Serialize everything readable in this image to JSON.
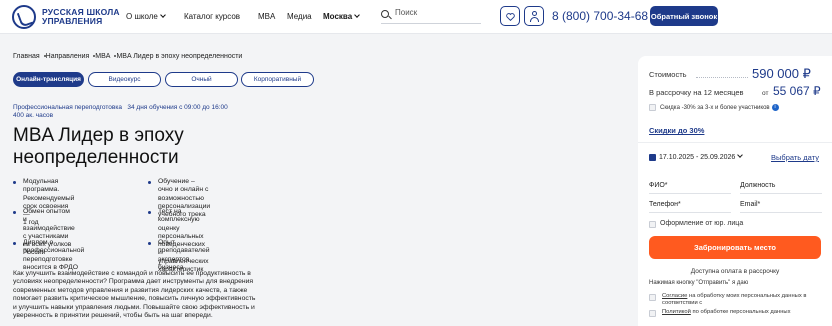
{
  "header": {
    "logo_line1": "РУССКАЯ ШКОЛА",
    "logo_line2": "УПРАВЛЕНИЯ",
    "nav": [
      "О школе",
      "Каталог курсов",
      "MBA",
      "Медиа",
      "Москва"
    ],
    "search_placeholder": "Поиск",
    "phone": "8 (800) 700-34-68",
    "callback": "Обратный звонок",
    "accent": "#1e3a8a"
  },
  "breadcrumb": [
    "Главная",
    "Направления",
    "MBA",
    "MBA Лидер в эпоху неопределенности"
  ],
  "tabs": [
    "Онлайн-трансляция",
    "Видеокурс",
    "Очный",
    "Корпоративный"
  ],
  "meta": {
    "label": "Профессиональная переподготовка",
    "duration": "34 дня обучения с 09:00 до 16:00",
    "hours": "400 ак. часов"
  },
  "title_line1": "MBA Лидер в эпоху",
  "title_line2": "неопределенности",
  "features_left": [
    [
      "Модульная программа.",
      "Рекомендуемый срок освоения —",
      "1 год"
    ],
    [
      "Обмен опытом и взаимодействие",
      "с участниками из всех уголков",
      "России"
    ],
    [
      "Диплом о профессиональной",
      "переподготовке вносится в ФРДО"
    ]
  ],
  "features_right": [
    [
      "Обучение – очно и онлайн с",
      "возможностью персонализации",
      "учебного трека"
    ],
    [
      "Тест на комплексную оценку",
      "персональных поведенческих и",
      "управленческих характеристик"
    ],
    [
      "Опыт преподавателей экспертов",
      "бизнеса"
    ]
  ],
  "description": [
    "Как улучшить взаимодействие с командой и повысить ее продуктивность в",
    "условиях неопределенности? Программа дает инструменты для внедрения",
    "современных методов управления и развития лидерских качеств, а также",
    "помогает развить критическое мышление, повысить личную эффективность",
    "и улучшить навыки управления людьми. Повышайте свою эффективность и",
    "уверенность в принятии решений, чтобы быть на шаг впереди."
  ],
  "card": {
    "cost_label": "Стоимость",
    "price": "590 000 ₽",
    "installment_label": "В рассрочку на 12 месяцев",
    "installment_from": "от",
    "installment_price": "55 067 ₽",
    "discount_text": "Скидка -30% за 3-х и более участников",
    "info": "i",
    "discount_link": "Скидки до 30%",
    "dates": "17.10.2025 - 25.09.2026",
    "choose_date": "Выбрать дату",
    "fields": [
      "ФИО*",
      "Должность",
      "Телефон*",
      "Email*"
    ],
    "legal": "Оформление от юр. лица",
    "book": "Забронировать место",
    "installment_note": "Доступна оплата в рассрочку",
    "agree_note": "Нажимая кнопку \"Отправить\" я даю",
    "consent1_link": "Согласие",
    "consent1_rest": "на обработку моих персональных данных в",
    "consent1_line2": "соответствии с",
    "consent2_link": "Политикой",
    "consent2_rest": "по обработке персональных данных",
    "cta_color": "#ff5a1f"
  }
}
